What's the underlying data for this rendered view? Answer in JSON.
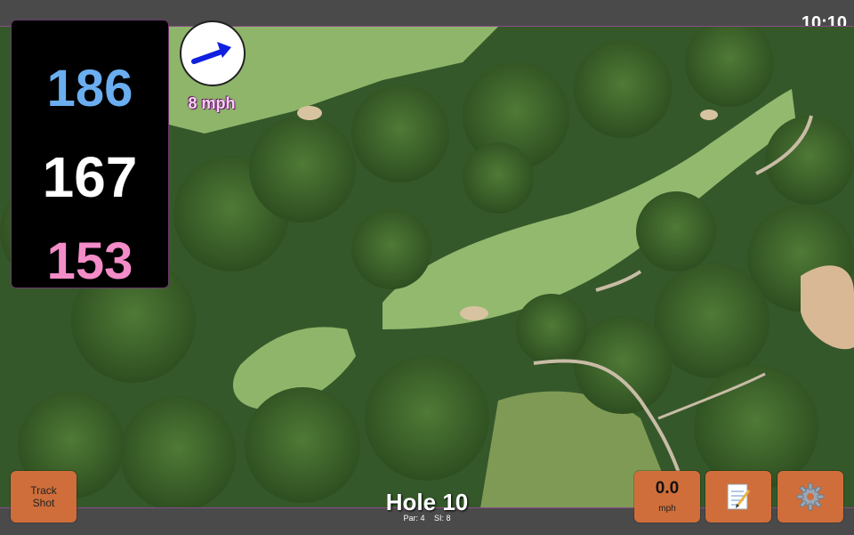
{
  "status": {
    "time": "10:10"
  },
  "distances": {
    "back": "186",
    "middle": "167",
    "front": "153"
  },
  "wind": {
    "speed": "8 mph",
    "icon": "wind-arrow-icon",
    "arrow_color": "#1020e0"
  },
  "hole": {
    "title": "Hole 10",
    "par": "Par: 4",
    "si": "SI: 8"
  },
  "buttons": {
    "track_line1": "Track",
    "track_line2": "Shot",
    "speed_value": "0.0",
    "speed_unit": "mph",
    "notes_icon": "notepad-icon",
    "settings_icon": "gear-icon"
  },
  "colors": {
    "button_bg": "#cf6e3a",
    "back_color": "#6aaef0",
    "front_color": "#f38cc8",
    "panel_border": "#6a3a6a"
  }
}
